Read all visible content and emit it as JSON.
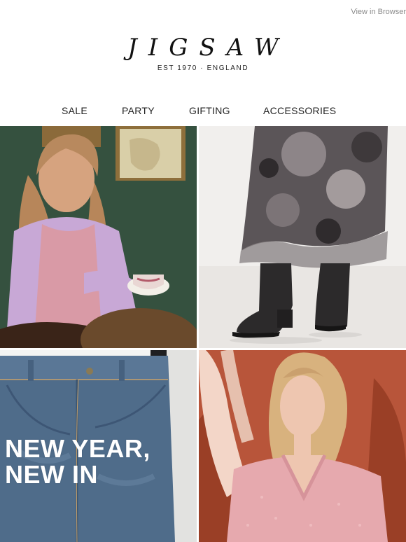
{
  "header": {
    "browser_link": "View in Browser",
    "brand_name": "JIGSAW",
    "brand_tagline": "EST 1970  ·  ENGLAND"
  },
  "nav": {
    "items": [
      "SALE",
      "PARTY",
      "GIFTING",
      "ACCESSORIES"
    ]
  },
  "hero": {
    "headline_line1": "NEW YEAR,",
    "headline_line2": "NEW IN"
  },
  "colors": {
    "background": "#ffffff",
    "text": "#111111",
    "muted_link": "#8a8a8a",
    "headline_text": "#ffffff"
  },
  "images": [
    {
      "icon": "photo-woman-lilac-cardigan-teacup"
    },
    {
      "icon": "photo-floral-skirt-black-boots"
    },
    {
      "icon": "photo-denim-jeans"
    },
    {
      "icon": "photo-woman-pink-knit-vest"
    }
  ]
}
